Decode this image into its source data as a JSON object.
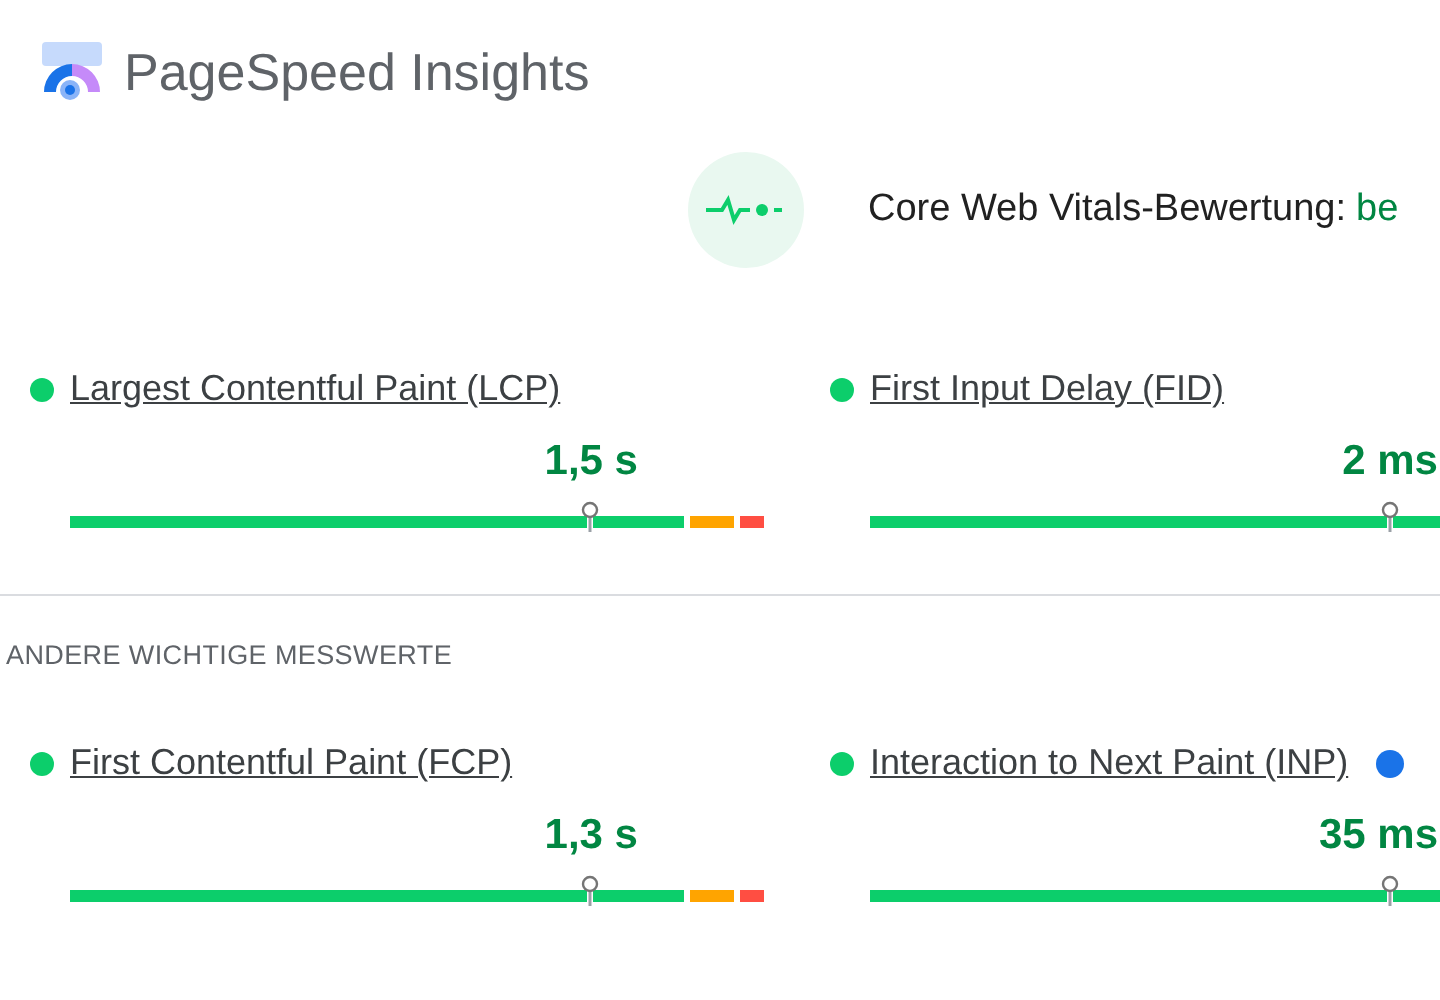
{
  "app": {
    "title": "PageSpeed Insights"
  },
  "assessment": {
    "label": "Core Web Vitals-Bewertung:",
    "result": "be"
  },
  "core_metrics": [
    {
      "name": "Largest Contentful Paint (LCP)",
      "color": "#0cce6b",
      "value": "1,5 s",
      "segments": [
        {
          "kind": "good"
        },
        {
          "kind": "average"
        },
        {
          "kind": "poor"
        }
      ]
    },
    {
      "name": "First Input Delay (FID)",
      "color": "#0cce6b",
      "value": "2 ms",
      "segments": [
        {
          "kind": "good"
        }
      ]
    }
  ],
  "other_section": {
    "heading": "ANDERE WICHTIGE MESSWERTE"
  },
  "other_metrics": [
    {
      "name": "First Contentful Paint (FCP)",
      "color": "#0cce6b",
      "value": "1,3 s",
      "segments": [
        {
          "kind": "good"
        },
        {
          "kind": "average"
        },
        {
          "kind": "poor"
        }
      ]
    },
    {
      "name": "Interaction to Next Paint (INP)",
      "color": "#0cce6b",
      "value": "35 ms",
      "segments": [
        {
          "kind": "good"
        }
      ],
      "info": true
    }
  ]
}
